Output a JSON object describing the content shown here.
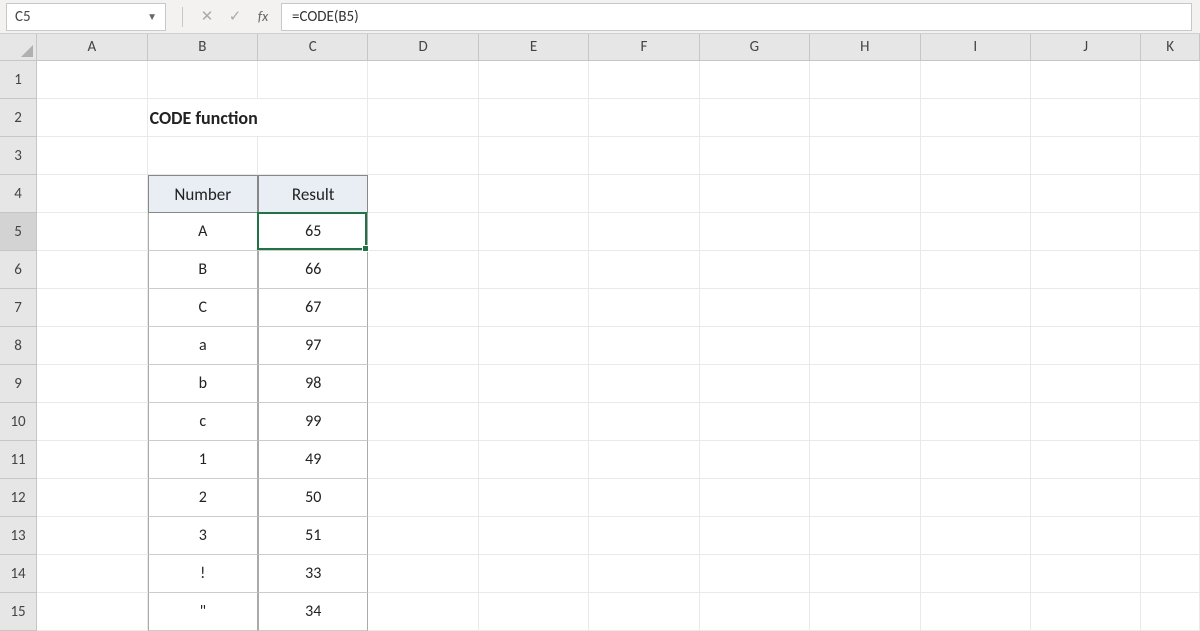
{
  "formatter": {
    "name_box": "C5",
    "formula": "=CODE(B5)"
  },
  "columns": [
    "A",
    "B",
    "C",
    "D",
    "E",
    "F",
    "G",
    "H",
    "I",
    "J",
    "K"
  ],
  "rows": [
    "1",
    "2",
    "3",
    "4",
    "5",
    "6",
    "7",
    "8",
    "9",
    "10",
    "11",
    "12",
    "13",
    "14",
    "15"
  ],
  "title": "CODE function",
  "headers": {
    "col_b": "Number",
    "col_c": "Result"
  },
  "data": [
    {
      "num": "A",
      "res": "65"
    },
    {
      "num": "B",
      "res": "66"
    },
    {
      "num": "C",
      "res": "67"
    },
    {
      "num": "a",
      "res": "97"
    },
    {
      "num": "b",
      "res": "98"
    },
    {
      "num": "c",
      "res": "99"
    },
    {
      "num": "1",
      "res": "49"
    },
    {
      "num": "2",
      "res": "50"
    },
    {
      "num": "3",
      "res": "51"
    },
    {
      "num": "!",
      "res": "33"
    },
    {
      "num": "\"",
      "res": "34"
    }
  ],
  "selection": {
    "cell": "C5"
  }
}
